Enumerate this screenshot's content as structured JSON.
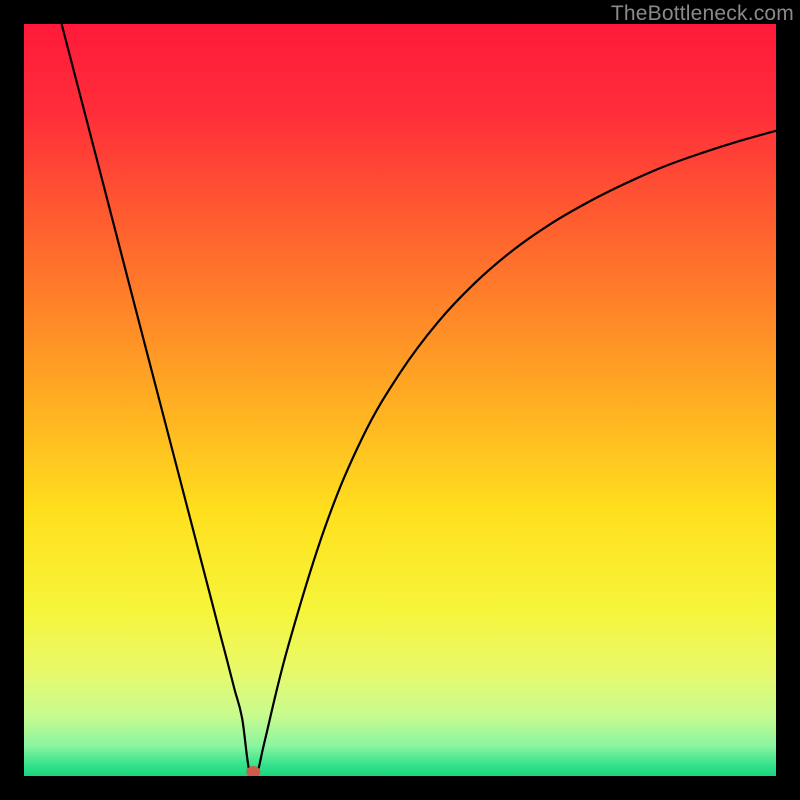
{
  "watermark": "TheBottleneck.com",
  "chart_data": {
    "type": "line",
    "title": "",
    "xlabel": "",
    "ylabel": "",
    "xlim": [
      0,
      100
    ],
    "ylim": [
      0,
      100
    ],
    "grid": false,
    "marker": {
      "x": 30.5,
      "y": 0,
      "color": "#cf5b4a",
      "radius": 7
    },
    "series": [
      {
        "name": "bottleneck-curve",
        "color": "#000000",
        "x": [
          5,
          10,
          15,
          20,
          25,
          26,
          27,
          28,
          29,
          30,
          31,
          32,
          35,
          40,
          45,
          50,
          55,
          60,
          65,
          70,
          75,
          80,
          85,
          90,
          95,
          100
        ],
        "y": [
          100,
          80.8,
          61.5,
          42.3,
          23.1,
          19.2,
          15.4,
          11.5,
          7.7,
          0.5,
          0.5,
          4.6,
          16.8,
          33.0,
          45.0,
          53.6,
          60.3,
          65.6,
          69.9,
          73.4,
          76.3,
          78.8,
          81.0,
          82.8,
          84.4,
          85.8
        ]
      }
    ],
    "background_gradient": {
      "stops": [
        {
          "offset": 0.0,
          "color": "#ff1a3a"
        },
        {
          "offset": 0.12,
          "color": "#ff2e3a"
        },
        {
          "offset": 0.3,
          "color": "#ff6a2d"
        },
        {
          "offset": 0.5,
          "color": "#ffad22"
        },
        {
          "offset": 0.65,
          "color": "#ffe01e"
        },
        {
          "offset": 0.78,
          "color": "#f6f53a"
        },
        {
          "offset": 0.86,
          "color": "#e8f96a"
        },
        {
          "offset": 0.92,
          "color": "#c7fb8f"
        },
        {
          "offset": 0.96,
          "color": "#8af5a0"
        },
        {
          "offset": 0.985,
          "color": "#35e28b"
        },
        {
          "offset": 1.0,
          "color": "#18d67e"
        }
      ]
    }
  }
}
